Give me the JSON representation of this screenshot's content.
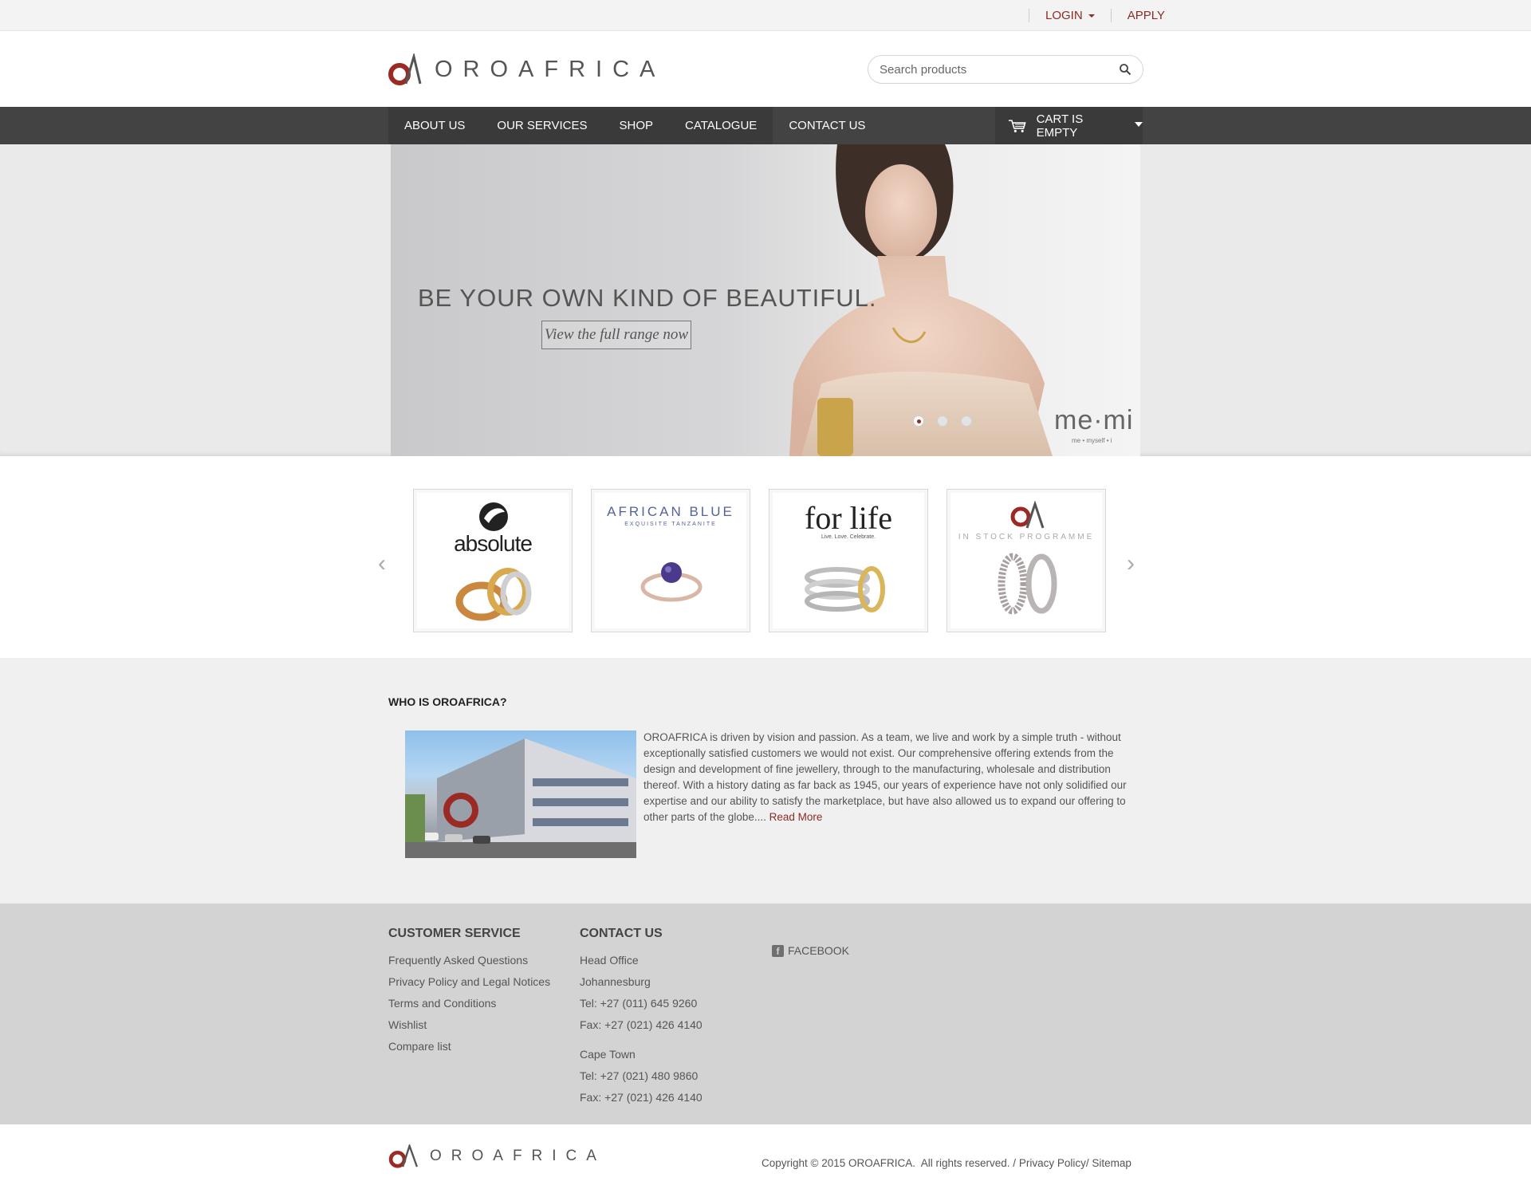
{
  "topbar": {
    "login": "LOGIN",
    "apply": "APPLY"
  },
  "header": {
    "logo_text": "OROAFRICA",
    "search_placeholder": "Search products"
  },
  "nav": {
    "items": [
      "ABOUT US",
      "OUR SERVICES",
      "SHOP",
      "CATALOGUE",
      "CONTACT US"
    ],
    "cart": "CART IS EMPTY"
  },
  "hero": {
    "headline": "BE YOUR OWN KIND OF BEAUTIFUL.",
    "cta": "View the full range now",
    "brand_mark": "me·mi",
    "brand_sub": "me • myself • i",
    "slide_count": 3,
    "active_slide": 1
  },
  "brands": [
    {
      "name": "absolute",
      "tagline": ""
    },
    {
      "name": "AFRICAN BLUE",
      "tagline": "EXQUISITE TANZANITE"
    },
    {
      "name": "for life",
      "tagline": "Live. Love. Celebrate."
    },
    {
      "name": "",
      "tagline": "IN STOCK PROGRAMME"
    }
  ],
  "who": {
    "title": "WHO IS OROAFRICA?",
    "body": "OROAFRICA is driven by vision and passion. As a team, we live and work by a simple truth - without exceptionally satisfied customers we would not exist. Our comprehensive offering extends from the design and development of fine jewellery, through to the manufacturing, wholesale and distribution thereof. With a history dating as far back as 1945, our years of experience have not only solidified our expertise and our ability to satisfy the marketplace, but have also allowed us to expand our offering to other parts of the globe....",
    "read_more": "Read More"
  },
  "footer": {
    "customer_service": {
      "title": "CUSTOMER SERVICE",
      "links": [
        "Frequently Asked Questions",
        "Privacy Policy and Legal Notices",
        "Terms and Conditions",
        "Wishlist",
        "Compare list"
      ]
    },
    "contact": {
      "title": "CONTACT US",
      "head_office": [
        "Head Office",
        "Johannesburg",
        "Tel: +27 (011) 645 9260",
        "Fax: +27 (021) 426 4140"
      ],
      "cape_town": [
        "Cape Town",
        "Tel: +27 (021) 480 9860",
        "Fax: +27 (021) 426 4140"
      ]
    },
    "facebook": "FACEBOOK"
  },
  "bottom": {
    "logo_text": "OROAFRICA",
    "copyright": "Copyright © 2015 OROAFRICA.  All rights reserved. / ",
    "privacy": "Privacy Policy",
    "sitemap": "Sitemap"
  },
  "colors": {
    "brand_red": "#9a2a23",
    "nav_bg": "#434343",
    "footer_bg": "#d3d3d3"
  },
  "icons": [
    "logo-mark-icon",
    "search-icon",
    "cart-icon",
    "chevron-left-icon",
    "chevron-right-icon",
    "facebook-icon"
  ]
}
